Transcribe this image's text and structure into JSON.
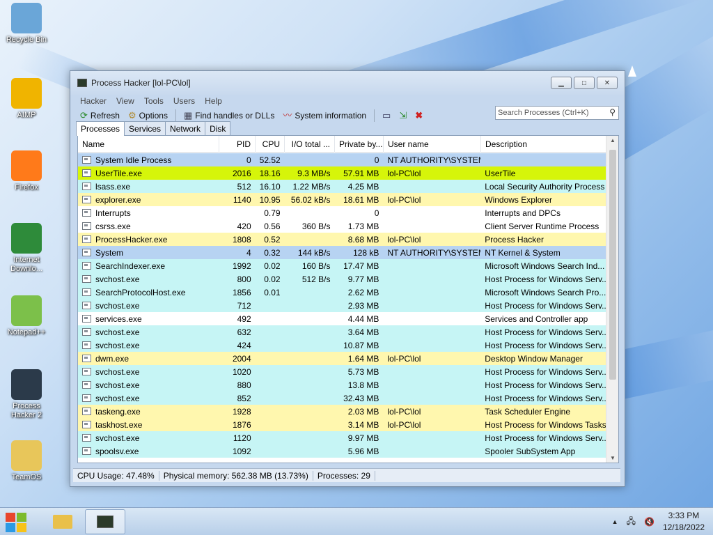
{
  "desktop": {
    "icons": [
      {
        "label": "Recycle Bin",
        "icon": "recycle-bin-icon",
        "color": "#6aa6d8"
      },
      {
        "label": "AIMP",
        "icon": "aimp-icon",
        "color": "#f0b400"
      },
      {
        "label": "Firefox",
        "icon": "firefox-icon",
        "color": "#ff7a1a"
      },
      {
        "label": "Internet Downlo...",
        "icon": "internet-download-manager-icon",
        "color": "#2e8b3a"
      },
      {
        "label": "Notepad++",
        "icon": "notepad-plus-plus-icon",
        "color": "#7cc04a"
      },
      {
        "label": "Process Hacker 2",
        "icon": "process-hacker-icon",
        "color": "#2b3a4a"
      },
      {
        "label": "TeamOS",
        "icon": "folder-icon",
        "color": "#e8c65a"
      }
    ]
  },
  "window": {
    "title": "Process Hacker [lol-PC\\lol]",
    "controls": {
      "minimize": "▁",
      "maximize": "□",
      "close": "✕"
    },
    "menu": [
      "Hacker",
      "View",
      "Tools",
      "Users",
      "Help"
    ],
    "toolbar": {
      "refresh": "Refresh",
      "options": "Options",
      "find_handles": "Find handles or DLLs",
      "system_info": "System information"
    },
    "search_placeholder": "Search Processes (Ctrl+K)",
    "tabs": [
      "Processes",
      "Services",
      "Network",
      "Disk"
    ],
    "columns": [
      "Name",
      "PID",
      "CPU",
      "I/O total ...",
      "Private by...",
      "User name",
      "Description"
    ],
    "processes": [
      {
        "name": "System Idle Process",
        "pid": "0",
        "cpu": "52.52",
        "io": "",
        "priv": "0",
        "user": "NT AUTHORITY\\SYSTEM",
        "desc": "",
        "color": "#b7d3f2"
      },
      {
        "name": "UserTile.exe",
        "pid": "2016",
        "cpu": "18.16",
        "io": "9.3 MB/s",
        "priv": "57.91 MB",
        "user": "lol-PC\\lol",
        "desc": "UserTile",
        "color": "#d6f50a"
      },
      {
        "name": "lsass.exe",
        "pid": "512",
        "cpu": "16.10",
        "io": "1.22 MB/s",
        "priv": "4.25 MB",
        "user": "",
        "desc": "Local Security Authority Process",
        "color": "#c6f5f5"
      },
      {
        "name": "explorer.exe",
        "pid": "1140",
        "cpu": "10.95",
        "io": "56.02 kB/s",
        "priv": "18.61 MB",
        "user": "lol-PC\\lol",
        "desc": "Windows Explorer",
        "color": "#fff7ae"
      },
      {
        "name": "Interrupts",
        "pid": "",
        "cpu": "0.79",
        "io": "",
        "priv": "0",
        "user": "",
        "desc": "Interrupts and DPCs",
        "color": "#ffffff"
      },
      {
        "name": "csrss.exe",
        "pid": "420",
        "cpu": "0.56",
        "io": "360 B/s",
        "priv": "1.73 MB",
        "user": "",
        "desc": "Client Server Runtime Process",
        "color": "#ffffff"
      },
      {
        "name": "ProcessHacker.exe",
        "pid": "1808",
        "cpu": "0.52",
        "io": "",
        "priv": "8.68 MB",
        "user": "lol-PC\\lol",
        "desc": "Process Hacker",
        "color": "#fff7ae"
      },
      {
        "name": "System",
        "pid": "4",
        "cpu": "0.32",
        "io": "144 kB/s",
        "priv": "128 kB",
        "user": "NT AUTHORITY\\SYSTEM",
        "desc": "NT Kernel & System",
        "color": "#b7d3f2"
      },
      {
        "name": "SearchIndexer.exe",
        "pid": "1992",
        "cpu": "0.02",
        "io": "160 B/s",
        "priv": "17.47 MB",
        "user": "",
        "desc": "Microsoft Windows Search Ind...",
        "color": "#c6f5f5"
      },
      {
        "name": "svchost.exe",
        "pid": "800",
        "cpu": "0.02",
        "io": "512 B/s",
        "priv": "9.77 MB",
        "user": "",
        "desc": "Host Process for Windows Serv...",
        "color": "#c6f5f5"
      },
      {
        "name": "SearchProtocolHost.exe",
        "pid": "1856",
        "cpu": "0.01",
        "io": "",
        "priv": "2.62 MB",
        "user": "",
        "desc": "Microsoft Windows Search Pro...",
        "color": "#c6f5f5"
      },
      {
        "name": "svchost.exe",
        "pid": "712",
        "cpu": "",
        "io": "",
        "priv": "2.93 MB",
        "user": "",
        "desc": "Host Process for Windows Serv...",
        "color": "#c6f5f5"
      },
      {
        "name": "services.exe",
        "pid": "492",
        "cpu": "",
        "io": "",
        "priv": "4.44 MB",
        "user": "",
        "desc": "Services and Controller app",
        "color": "#ffffff"
      },
      {
        "name": "svchost.exe",
        "pid": "632",
        "cpu": "",
        "io": "",
        "priv": "3.64 MB",
        "user": "",
        "desc": "Host Process for Windows Serv...",
        "color": "#c6f5f5"
      },
      {
        "name": "svchost.exe",
        "pid": "424",
        "cpu": "",
        "io": "",
        "priv": "10.87 MB",
        "user": "",
        "desc": "Host Process for Windows Serv...",
        "color": "#c6f5f5"
      },
      {
        "name": "dwm.exe",
        "pid": "2004",
        "cpu": "",
        "io": "",
        "priv": "1.64 MB",
        "user": "lol-PC\\lol",
        "desc": "Desktop Window Manager",
        "color": "#fff7ae"
      },
      {
        "name": "svchost.exe",
        "pid": "1020",
        "cpu": "",
        "io": "",
        "priv": "5.73 MB",
        "user": "",
        "desc": "Host Process for Windows Serv...",
        "color": "#c6f5f5"
      },
      {
        "name": "svchost.exe",
        "pid": "880",
        "cpu": "",
        "io": "",
        "priv": "13.8 MB",
        "user": "",
        "desc": "Host Process for Windows Serv...",
        "color": "#c6f5f5"
      },
      {
        "name": "svchost.exe",
        "pid": "852",
        "cpu": "",
        "io": "",
        "priv": "32.43 MB",
        "user": "",
        "desc": "Host Process for Windows Serv...",
        "color": "#c6f5f5"
      },
      {
        "name": "taskeng.exe",
        "pid": "1928",
        "cpu": "",
        "io": "",
        "priv": "2.03 MB",
        "user": "lol-PC\\lol",
        "desc": "Task Scheduler Engine",
        "color": "#fff7ae"
      },
      {
        "name": "taskhost.exe",
        "pid": "1876",
        "cpu": "",
        "io": "",
        "priv": "3.14 MB",
        "user": "lol-PC\\lol",
        "desc": "Host Process for Windows Tasks",
        "color": "#fff7ae"
      },
      {
        "name": "svchost.exe",
        "pid": "1120",
        "cpu": "",
        "io": "",
        "priv": "9.97 MB",
        "user": "",
        "desc": "Host Process for Windows Serv...",
        "color": "#c6f5f5"
      },
      {
        "name": "spoolsv.exe",
        "pid": "1092",
        "cpu": "",
        "io": "",
        "priv": "5.96 MB",
        "user": "",
        "desc": "Spooler SubSystem App",
        "color": "#c6f5f5"
      }
    ],
    "status": {
      "cpu": "CPU Usage: 47.48%",
      "memory": "Physical memory: 562.38 MB (13.73%)",
      "processes": "Processes: 29"
    }
  },
  "taskbar": {
    "time": "3:33 PM",
    "date": "12/18/2022"
  }
}
